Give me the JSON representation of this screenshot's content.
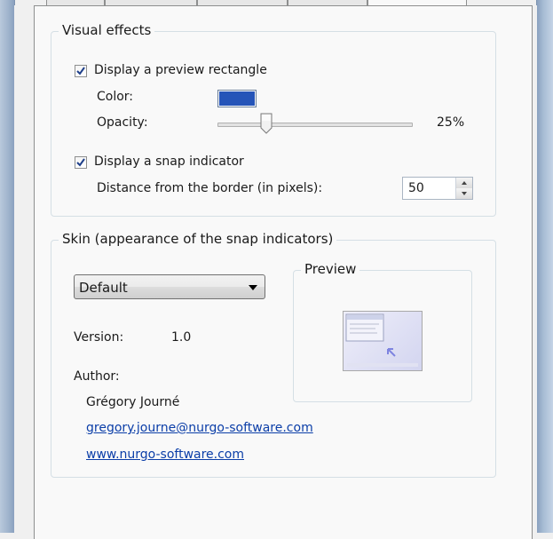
{
  "visual_effects": {
    "title": "Visual effects",
    "preview_rect": {
      "label": "Display a preview rectangle",
      "checked": true
    },
    "color_label": "Color:",
    "color_value": "#2554b8",
    "opacity_label": "Opacity:",
    "opacity_value": "25%",
    "opacity_fraction": 0.25,
    "snap_indicator": {
      "label": "Display a snap indicator",
      "checked": true
    },
    "distance_label": "Distance from the border (in pixels):",
    "distance_value": "50"
  },
  "skin": {
    "title": "Skin (appearance of the snap indicators)",
    "selected": "Default",
    "version_label": "Version:",
    "version_value": "1.0",
    "author_label": "Author:",
    "author_name": "Grégory Journé",
    "email": "gregory.journe@nurgo-software.com",
    "website": "www.nurgo-software.com",
    "preview_title": "Preview"
  }
}
